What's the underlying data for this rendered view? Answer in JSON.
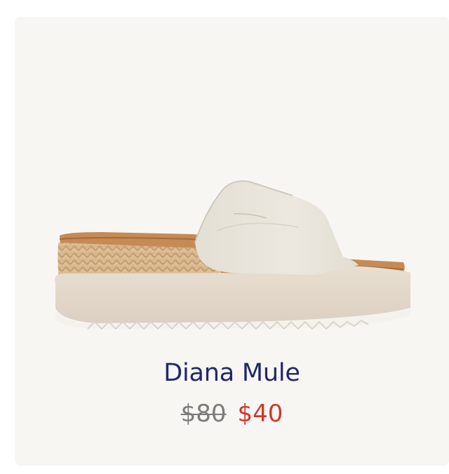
{
  "product": {
    "name": "Diana Mule",
    "price_original": "$80",
    "price_sale": "$40",
    "image_icon": "platform-wedge-sandal-image"
  },
  "colors": {
    "card_background": "#f7f6f3",
    "title": "#1f276b",
    "original_price": "#7b7b7b",
    "sale_price": "#d0372b"
  }
}
